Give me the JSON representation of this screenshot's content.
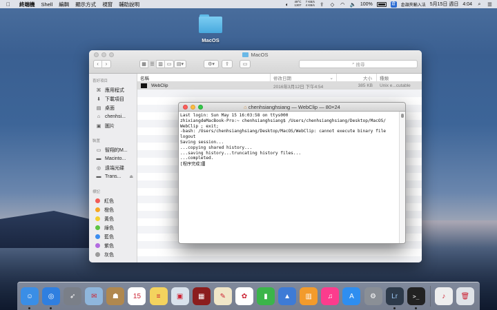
{
  "menubar": {
    "apple": "",
    "app_name": "終端機",
    "items": [
      "Shell",
      "編輯",
      "顯示方式",
      "視窗",
      "輔助說明"
    ],
    "temp": "49°C",
    "temp_sub": "1307",
    "net_up": "7 KB/s",
    "net_down": "4 KB/s",
    "battery": "100%",
    "input_flag": "倉",
    "input_method": "倉頡夾輸入法",
    "date": "5月15日 週日",
    "time": "4:04"
  },
  "desktop": {
    "folder_label": "MacOS"
  },
  "finder": {
    "title": "MacOS",
    "search_placeholder": "搜尋",
    "sidebar": {
      "favorites_header": "喜好項目",
      "favorites": [
        {
          "label": "應用程式",
          "icon": "apps-icon"
        },
        {
          "label": "下載項目",
          "icon": "download-icon"
        },
        {
          "label": "桌面",
          "icon": "desktop-icon"
        },
        {
          "label": "chenhsi...",
          "icon": "home-icon"
        },
        {
          "label": "圖片",
          "icon": "pictures-icon"
        }
      ],
      "devices_header": "裝置",
      "devices": [
        {
          "label": "智翔的M...",
          "icon": "computer-icon"
        },
        {
          "label": "Macinto...",
          "icon": "disk-icon"
        },
        {
          "label": "遠端光碟",
          "icon": "disc-icon"
        },
        {
          "label": "Trans...",
          "icon": "disk-icon"
        }
      ],
      "tags_header": "標記",
      "tags": [
        {
          "label": "紅色",
          "color": "#f15b57"
        },
        {
          "label": "橙色",
          "color": "#f5a623"
        },
        {
          "label": "黃色",
          "color": "#f3cf2e"
        },
        {
          "label": "綠色",
          "color": "#5ec443"
        },
        {
          "label": "藍色",
          "color": "#3c8ef0"
        },
        {
          "label": "紫色",
          "color": "#b26be0"
        },
        {
          "label": "灰色",
          "color": "#9b9b9b"
        }
      ]
    },
    "columns": {
      "name": "名稱",
      "date": "修改日期",
      "size": "大小",
      "kind": "種類"
    },
    "files": [
      {
        "name": "WebClip",
        "date": "2016年3月12日 下午4:54",
        "size": "385 KB",
        "kind": "Unix e...cutable"
      }
    ]
  },
  "terminal": {
    "title": "chenhsianghsiang — WebClip — 80×24",
    "lines": [
      "Last login: Sun May 15 16:03:58 on ttys000",
      "zhixiangdeMacBook-Pro:~ chenhsianghsiang$ /Users/chenhsianghsiang/Desktop/MacOS/",
      "WebClip ; exit;",
      "-bash: /Users/chenhsianghsiang/Desktop/MacOS/WebClip: cannot execute binary file",
      "logout",
      "Saving session...",
      "...copying shared history...",
      "...saving history...truncating history files...",
      "...completed.",
      "",
      "[程序完成]"
    ]
  },
  "dock": {
    "apps": [
      {
        "name": "finder",
        "color": "#3a8ee6",
        "glyph": "☺",
        "running": true
      },
      {
        "name": "safari",
        "color": "#2f7fe0",
        "glyph": "◎",
        "running": true
      },
      {
        "name": "launchpad",
        "color": "#7a7f88",
        "glyph": "➶",
        "running": false
      },
      {
        "name": "mail-stamp",
        "color": "#8fb6dc",
        "glyph": "✉",
        "running": false
      },
      {
        "name": "contacts",
        "color": "#b0884f",
        "glyph": "☗",
        "running": false
      },
      {
        "name": "calendar",
        "color": "#ffffff",
        "glyph": "15",
        "running": false
      },
      {
        "name": "notes",
        "color": "#f4d35e",
        "glyph": "≡",
        "running": false
      },
      {
        "name": "preview",
        "color": "#d9e2ec",
        "glyph": "▣",
        "running": false
      },
      {
        "name": "photo-booth",
        "color": "#8b1d1d",
        "glyph": "▦",
        "running": false
      },
      {
        "name": "textedit",
        "color": "#f0e6c8",
        "glyph": "✎",
        "running": false
      },
      {
        "name": "photos",
        "color": "#ffffff",
        "glyph": "✿",
        "running": false
      },
      {
        "name": "numbers",
        "color": "#3bb54a",
        "glyph": "▮",
        "running": false
      },
      {
        "name": "keynote",
        "color": "#3e7bd6",
        "glyph": "▲",
        "running": false
      },
      {
        "name": "ibooks",
        "color": "#f29b2c",
        "glyph": "▥",
        "running": false
      },
      {
        "name": "itunes",
        "color": "#fc3c8d",
        "glyph": "♫",
        "running": false
      },
      {
        "name": "app-store",
        "color": "#2e8ef0",
        "glyph": "A",
        "running": false
      },
      {
        "name": "system-preferences",
        "color": "#8a8f96",
        "glyph": "⚙",
        "running": false
      },
      {
        "name": "lightroom",
        "color": "#2d3a4a",
        "glyph": "Lr",
        "running": true
      },
      {
        "name": "terminal",
        "color": "#222222",
        "glyph": ">_",
        "running": true
      }
    ],
    "trailing": [
      {
        "name": "music-folder",
        "color": "#eeeeee",
        "glyph": "♪"
      },
      {
        "name": "trash",
        "color": "#dfe3e8",
        "glyph": "🗑"
      }
    ]
  }
}
